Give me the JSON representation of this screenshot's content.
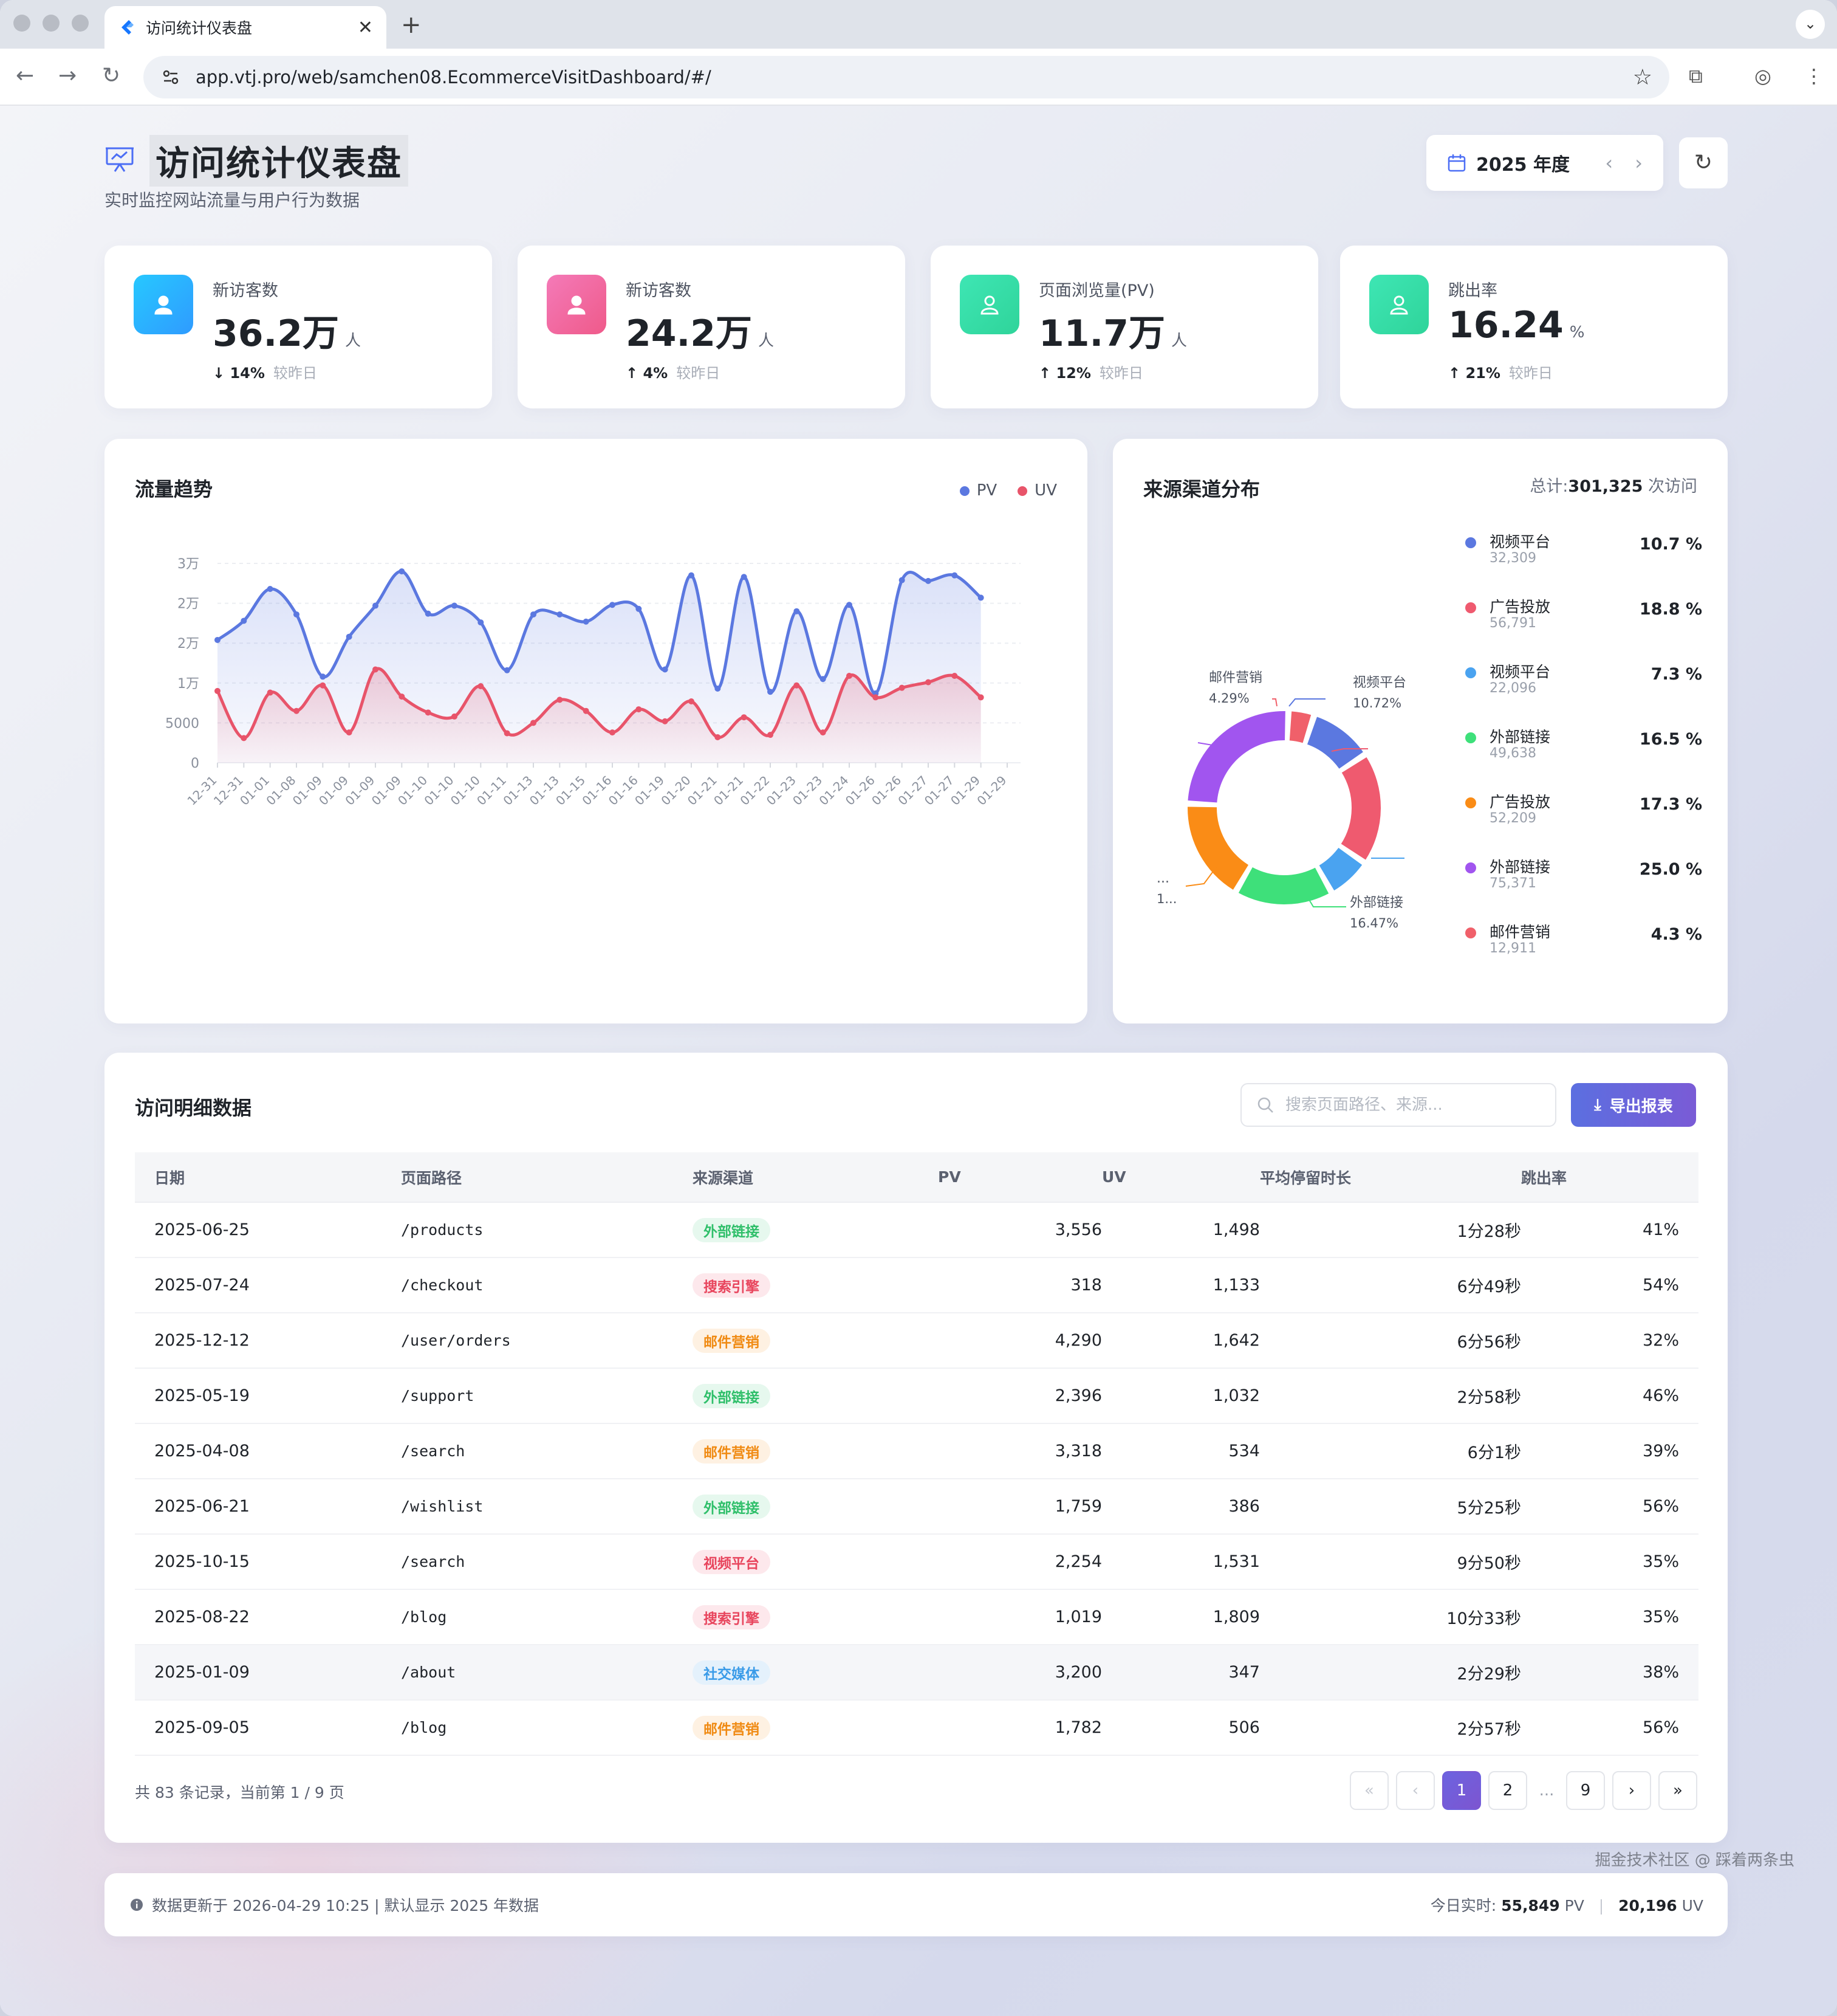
{
  "browser": {
    "tab_title": "访问统计仪表盘",
    "new_tab": "+",
    "url": "app.vtj.pro/web/samchen08.EcommerceVisitDashboard/#/"
  },
  "header": {
    "title": "访问统计仪表盘",
    "subtitle": "实时监控网站流量与用户行为数据",
    "year_label": "2025 年度"
  },
  "stats": [
    {
      "label": "新访客数",
      "value": "36.2万",
      "unit": "人",
      "arrow": "↓",
      "delta": "14%",
      "compare": "较昨日",
      "colors": [
        "#27c8ff",
        "#2f9bff"
      ]
    },
    {
      "label": "新访客数",
      "value": "24.2万",
      "unit": "人",
      "arrow": "↑",
      "delta": "4%",
      "compare": "较昨日",
      "colors": [
        "#f47ab8",
        "#ef5a8a"
      ]
    },
    {
      "label": "页面浏览量(PV)",
      "value": "11.7万",
      "unit": "人",
      "arrow": "↑",
      "delta": "12%",
      "compare": "较昨日",
      "colors": [
        "#3ee6b4",
        "#2fd49a"
      ]
    },
    {
      "label": "跳出率",
      "value": "16.24",
      "unit": "%",
      "arrow": "↑",
      "delta": "21%",
      "compare": "较昨日",
      "colors": [
        "#3ee6b4",
        "#2fd49a"
      ]
    }
  ],
  "trend": {
    "title": "流量趋势",
    "legend": [
      {
        "name": "PV",
        "color": "#5b78e0"
      },
      {
        "name": "UV",
        "color": "#e8546a"
      }
    ]
  },
  "chart_data": [
    {
      "type": "area",
      "title": "流量趋势",
      "y_ticks": [
        "0",
        "5000",
        "1万",
        "2万",
        "2万",
        "3万"
      ],
      "ylim": [
        0,
        25000
      ],
      "categories": [
        "12-31",
        "12-31",
        "01-01",
        "01-08",
        "01-09",
        "01-09",
        "01-09",
        "01-09",
        "01-10",
        "01-10",
        "01-10",
        "01-11",
        "01-13",
        "01-13",
        "01-15",
        "01-16",
        "01-16",
        "01-19",
        "01-20",
        "01-21",
        "01-21",
        "01-22",
        "01-23",
        "01-23",
        "01-24",
        "01-26",
        "01-26",
        "01-27",
        "01-27",
        "01-29",
        "01-29"
      ],
      "series": [
        {
          "name": "PV",
          "color": "#5b78e0",
          "x_index": [
            0,
            1,
            2,
            3,
            4,
            5,
            6,
            7,
            8,
            9,
            10,
            11,
            12,
            13,
            14,
            15,
            16,
            17,
            18,
            19,
            20,
            21,
            22,
            23,
            24,
            25,
            26,
            27,
            28,
            29,
            30
          ],
          "values": [
            15400,
            17800,
            21800,
            18600,
            10800,
            15800,
            19700,
            24000,
            18700,
            19700,
            17600,
            11600,
            18600,
            18600,
            17700,
            19800,
            19300,
            11700,
            23500,
            9300,
            23300,
            8900,
            19000,
            10500,
            19800,
            8700,
            22900,
            22800,
            23500,
            20700,
            null
          ]
        },
        {
          "name": "UV",
          "color": "#e8546a",
          "values": [
            9000,
            3100,
            8800,
            6500,
            9700,
            3800,
            11700,
            8300,
            6300,
            5800,
            9600,
            3700,
            5000,
            7900,
            6500,
            3800,
            6700,
            5200,
            7700,
            3200,
            5700,
            3500,
            9700,
            3800,
            10900,
            8200,
            9400,
            10100,
            10900,
            8200,
            null
          ]
        }
      ]
    },
    {
      "type": "pie",
      "title": "来源渠道分布",
      "total_label": "总计:",
      "total_value": "301,325",
      "total_unit": "次访问",
      "slices": [
        {
          "name": "视频平台",
          "count": "32,309",
          "percent": "10.7 %",
          "value": 10.72,
          "color": "#5b78e0"
        },
        {
          "name": "广告投放",
          "count": "56,791",
          "percent": "18.8 %",
          "value": 18.8,
          "color": "#ef5a6f"
        },
        {
          "name": "视频平台",
          "count": "22,096",
          "percent": "7.3 %",
          "value": 7.3,
          "color": "#4aa3f0"
        },
        {
          "name": "外部链接",
          "count": "49,638",
          "percent": "16.5 %",
          "value": 16.47,
          "color": "#3ee07a"
        },
        {
          "name": "广告投放",
          "count": "52,209",
          "percent": "17.3 %",
          "value": 17.3,
          "color": "#fa8c16"
        },
        {
          "name": "外部链接",
          "count": "75,371",
          "percent": "25.0 %",
          "value": 25.0,
          "color": "#a155ef"
        },
        {
          "name": "邮件营销",
          "count": "12,911",
          "percent": "4.3 %",
          "value": 4.29,
          "color": "#f0606a"
        }
      ],
      "outer_labels": [
        {
          "name": "邮件营销",
          "pct": "4.29%"
        },
        {
          "name": "视频平台",
          "pct": "10.72%"
        },
        {
          "name": "外部链接",
          "pct": "16.47%"
        },
        {
          "name": "...",
          "pct": "1..."
        }
      ]
    }
  ],
  "table": {
    "title": "访问明细数据",
    "search_placeholder": "搜索页面路径、来源...",
    "export_label": "导出报表",
    "columns": [
      "日期",
      "页面路径",
      "来源渠道",
      "PV",
      "UV",
      "平均停留时长",
      "跳出率"
    ],
    "rows": [
      {
        "date": "2025-06-25",
        "path": "/products",
        "source": "外部链接",
        "pv": "3,556",
        "uv": "1,498",
        "stay": "1分28秒",
        "bounce": "41%"
      },
      {
        "date": "2025-07-24",
        "path": "/checkout",
        "source": "搜索引擎",
        "pv": "318",
        "uv": "1,133",
        "stay": "6分49秒",
        "bounce": "54%"
      },
      {
        "date": "2025-12-12",
        "path": "/user/orders",
        "source": "邮件营销",
        "pv": "4,290",
        "uv": "1,642",
        "stay": "6分56秒",
        "bounce": "32%"
      },
      {
        "date": "2025-05-19",
        "path": "/support",
        "source": "外部链接",
        "pv": "2,396",
        "uv": "1,032",
        "stay": "2分58秒",
        "bounce": "46%"
      },
      {
        "date": "2025-04-08",
        "path": "/search",
        "source": "邮件营销",
        "pv": "3,318",
        "uv": "534",
        "stay": "6分1秒",
        "bounce": "39%"
      },
      {
        "date": "2025-06-21",
        "path": "/wishlist",
        "source": "外部链接",
        "pv": "1,759",
        "uv": "386",
        "stay": "5分25秒",
        "bounce": "56%"
      },
      {
        "date": "2025-10-15",
        "path": "/search",
        "source": "视频平台",
        "pv": "2,254",
        "uv": "1,531",
        "stay": "9分50秒",
        "bounce": "35%"
      },
      {
        "date": "2025-08-22",
        "path": "/blog",
        "source": "搜索引擎",
        "pv": "1,019",
        "uv": "1,809",
        "stay": "10分33秒",
        "bounce": "35%"
      },
      {
        "date": "2025-01-09",
        "path": "/about",
        "source": "社交媒体",
        "pv": "3,200",
        "uv": "347",
        "stay": "2分29秒",
        "bounce": "38%"
      },
      {
        "date": "2025-09-05",
        "path": "/blog",
        "source": "邮件营销",
        "pv": "1,782",
        "uv": "506",
        "stay": "2分57秒",
        "bounce": "56%"
      }
    ],
    "tag_colors": {
      "外部链接": {
        "fg": "#2fbf6a",
        "bg": "#e6f8ee"
      },
      "搜索引擎": {
        "fg": "#e8455d",
        "bg": "#fde8ec"
      },
      "邮件营销": {
        "fg": "#f08a12",
        "bg": "#fef1e2"
      },
      "视频平台": {
        "fg": "#e8455d",
        "bg": "#fde8ec"
      },
      "社交媒体": {
        "fg": "#3a9be8",
        "bg": "#e4f1fc"
      }
    },
    "pagination_info": "共 83 条记录，当前第 1 / 9 页",
    "pages": [
      "1",
      "2",
      "...",
      "9"
    ]
  },
  "footer": {
    "update_text": "数据更新于 2026-04-29 10:25 | 默认显示 2025 年数据",
    "realtime_label": "今日实时:",
    "pv_value": "55,849",
    "pv_unit": "PV",
    "uv_value": "20,196",
    "uv_unit": "UV"
  },
  "watermark": "掘金技术社区 @ 踩着两条虫"
}
